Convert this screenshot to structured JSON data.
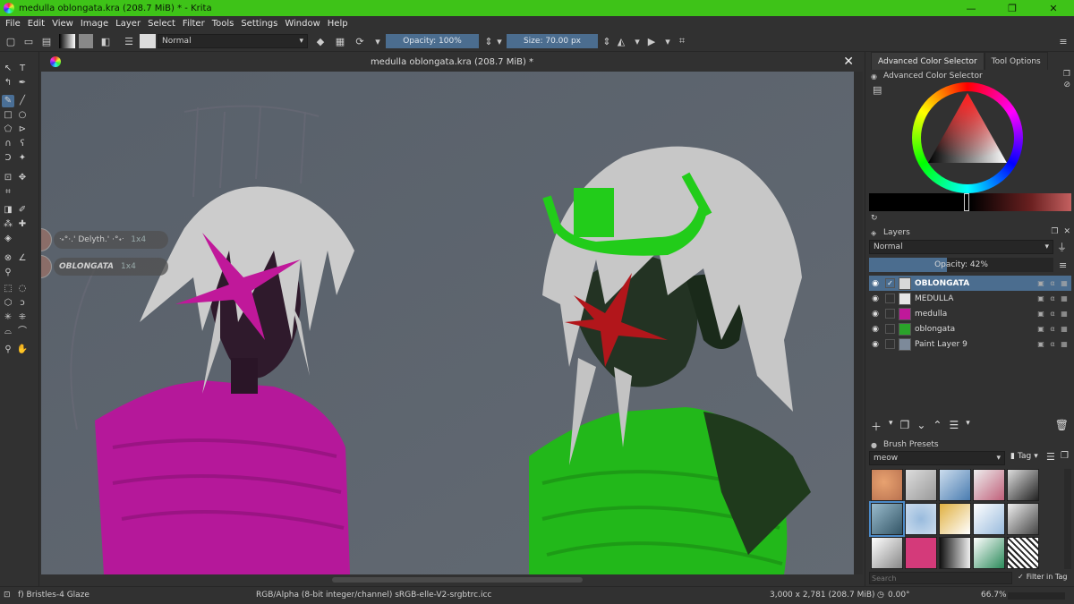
{
  "window": {
    "title": "medulla oblongata.kra (208.7 MiB) * - Krita",
    "minimize": "—",
    "maximize": "❐",
    "close": "✕",
    "titlebar_color": "#3ec318"
  },
  "menu": [
    "File",
    "Edit",
    "View",
    "Image",
    "Layer",
    "Select",
    "Filter",
    "Tools",
    "Settings",
    "Window",
    "Help"
  ],
  "toolbar": {
    "blend_mode": "Normal",
    "opacity": "Opacity: 100%",
    "opacity_fraction": 1.0,
    "size": "Size: 70.00 px",
    "accent": "#4b6d8f"
  },
  "document": {
    "tab_title": "medulla oblongata.kra (208.7 MiB) *",
    "close": "✕"
  },
  "canvas_chips": [
    {
      "name": "ᐧ˖°‧.' Delyth.' ‧°˖ᐧ",
      "tag": "1x4"
    },
    {
      "name": "OBLONGATA",
      "tag": "1x4"
    }
  ],
  "dock": {
    "tabs": [
      "Advanced Color Selector",
      "Tool Options"
    ],
    "color_selector_title": "Advanced Color Selector",
    "layers_title": "Layers",
    "layers_blend": "Normal",
    "layers_opacity": "Opacity:  42%",
    "layers_opacity_fraction": 0.42,
    "layers": [
      {
        "name": "OBLONGATA",
        "selected": true,
        "checked": true,
        "thumb": "#d8d8d8"
      },
      {
        "name": "MEDULLA",
        "selected": false,
        "checked": false,
        "thumb": "#e6e6e6"
      },
      {
        "name": "medulla",
        "selected": false,
        "checked": false,
        "thumb": "#c0189a"
      },
      {
        "name": "oblongata",
        "selected": false,
        "checked": false,
        "thumb": "#2aa32a"
      },
      {
        "name": "Paint Layer 9",
        "selected": false,
        "checked": false,
        "thumb": "#7d8a9a"
      }
    ],
    "brush_presets_title": "Brush Presets",
    "brush_tag_filter": "meow",
    "tag_label": "Tag",
    "search_placeholder": "Search",
    "filter_in_tag": "Filter in Tag"
  },
  "status": {
    "brush": "f) Bristles-4 Glaze",
    "color_space": "RGB/Alpha (8-bit integer/channel)  sRGB-elle-V2-srgbtrc.icc",
    "dimensions": "3,000 x 2,781 (208.7 MiB)",
    "rotation": "0.00°",
    "zoom": "66.7%"
  },
  "colors": {
    "canvas_bg": "#5d646e",
    "magenta": "#c0189a",
    "green": "#22b81a",
    "red_accent": "#b2161b"
  }
}
